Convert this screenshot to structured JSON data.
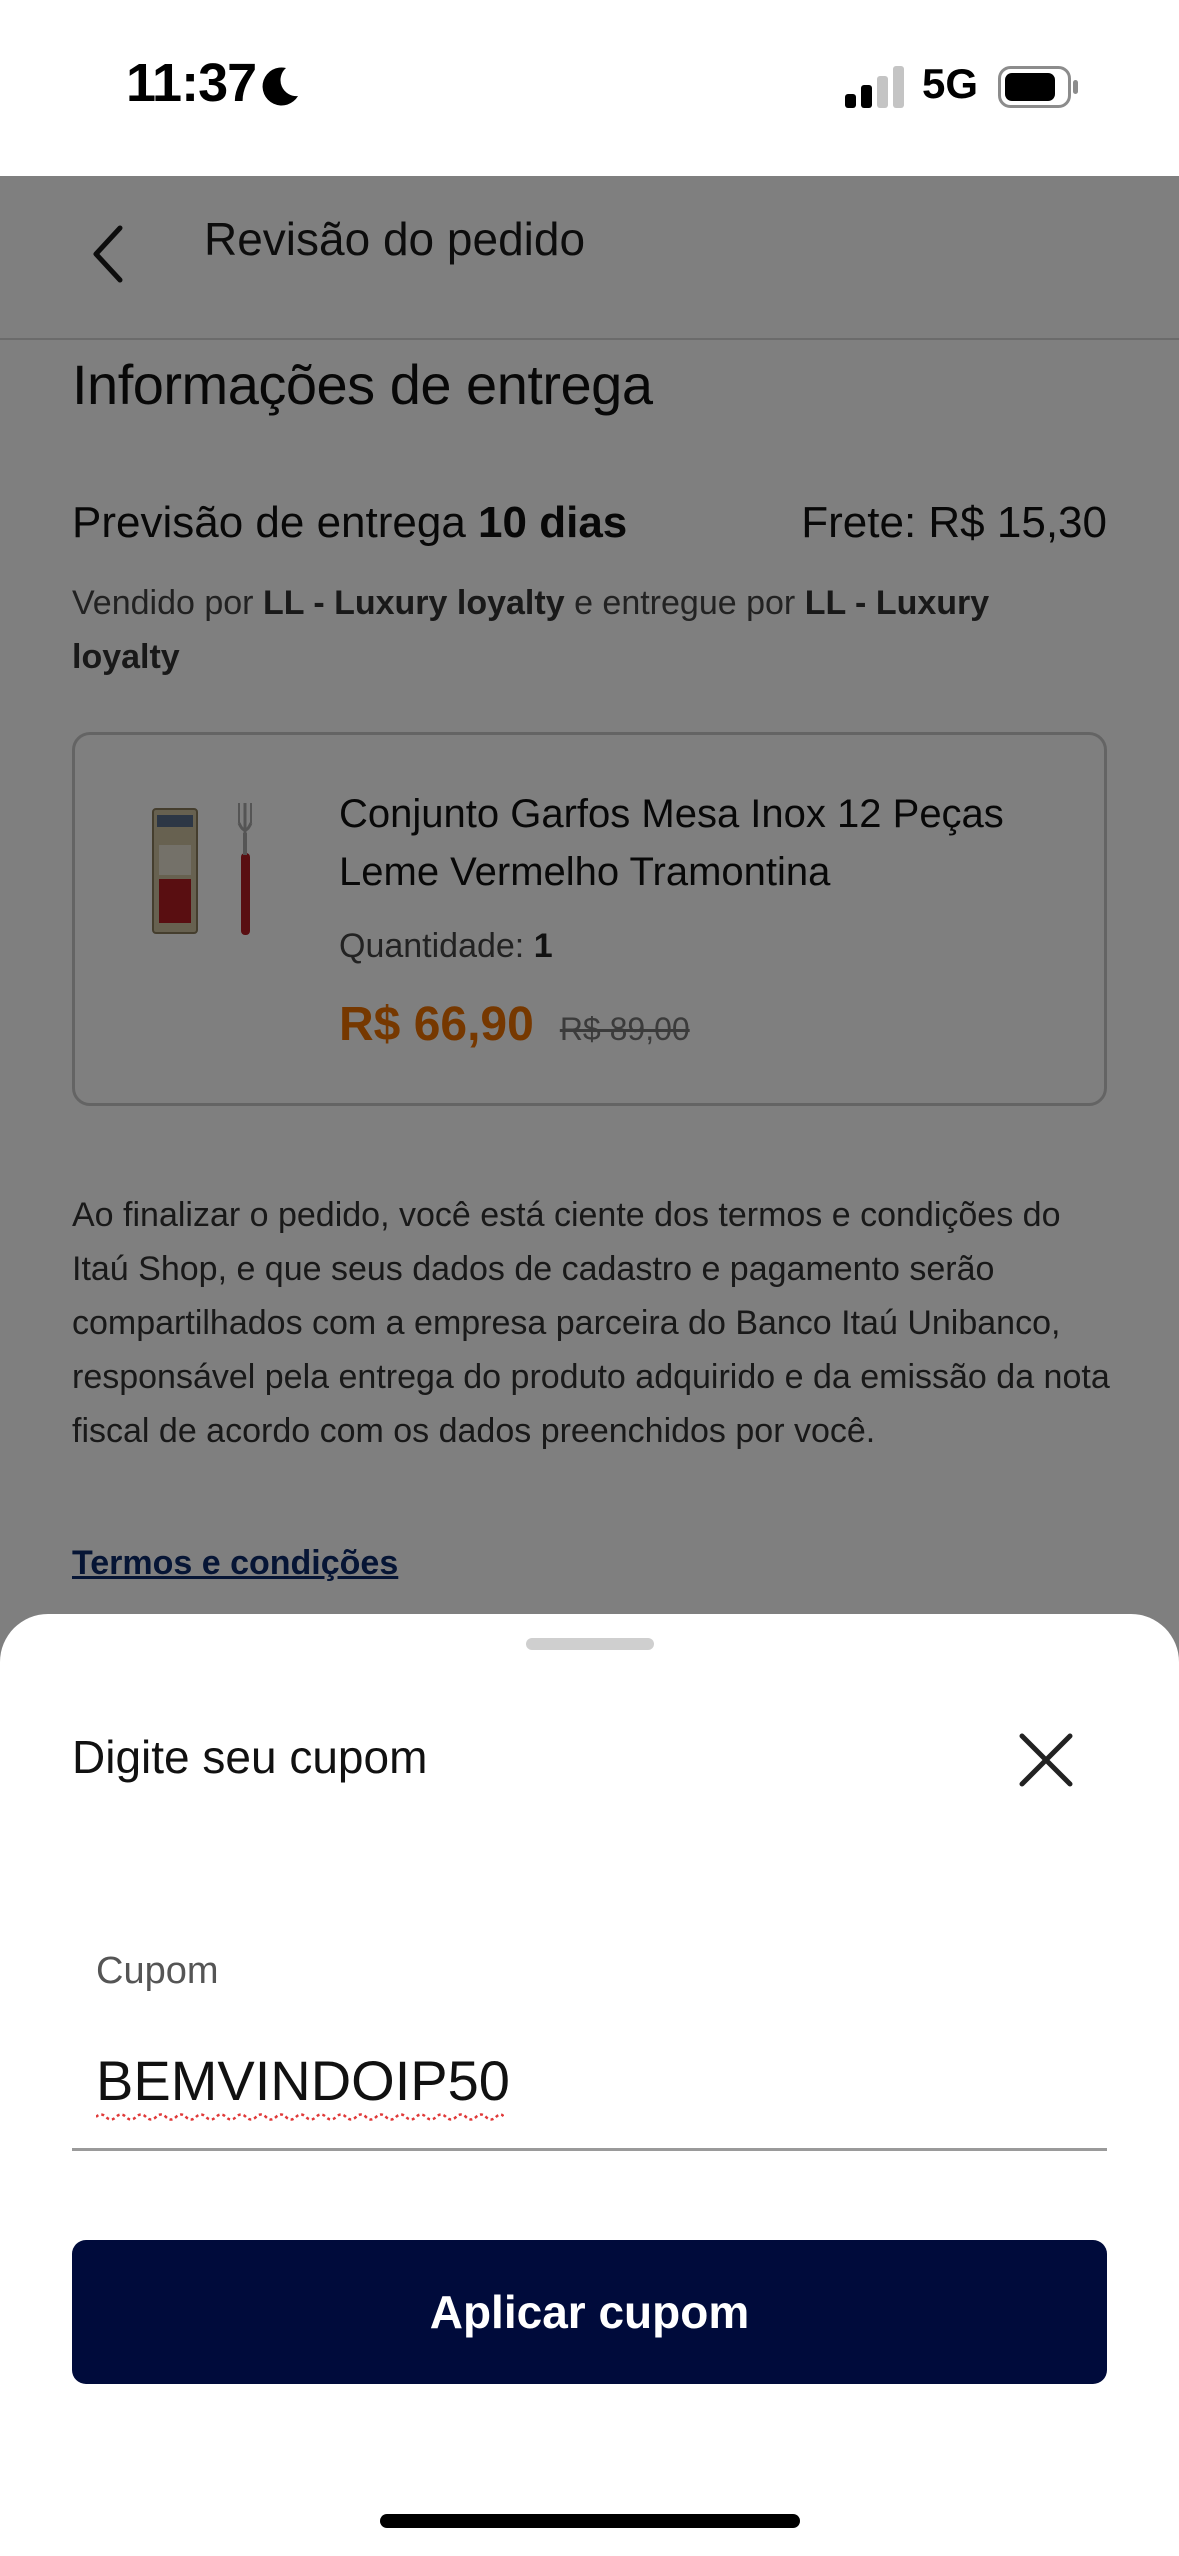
{
  "status_bar": {
    "time": "11:37",
    "network": "5G",
    "icons": [
      "moon-icon",
      "cellular-signal-icon",
      "battery-icon"
    ]
  },
  "header": {
    "title": "Revisão do pedido",
    "back_icon": "chevron-left-icon"
  },
  "delivery": {
    "section_title": "Informações de entrega",
    "eta_prefix": "Previsão de entrega",
    "eta_value": "10 dias",
    "shipping": "Frete: R$ 15,30",
    "sold_by_prefix": "Vendido por",
    "seller": "LL - Luxury loyalty",
    "delivered_by_prefix": "e entregue por",
    "deliverer": "LL - Luxury loyalty"
  },
  "product": {
    "name": "Conjunto Garfos Mesa Inox 12 Peças Leme Vermelho Tramontina",
    "quantity_label": "Quantidade:",
    "quantity": "1",
    "price": "R$ 66,90",
    "old_price": "R$ 89,00"
  },
  "disclaimer": "Ao finalizar o pedido, você está ciente dos termos e condições do Itaú Shop, e que seus dados de cadastro e pagamento serão compartilhados com a empresa parceira do Banco Itaú Unibanco, responsável pela entrega do produto adquirido e da emissão da nota fiscal de acordo com os dados preenchidos por você.",
  "terms_link": "Termos e condições",
  "coupon_sheet": {
    "title": "Digite seu cupom",
    "close_icon": "close-icon",
    "field_label": "Cupom",
    "field_value": "BEMVINDOIP50",
    "apply_button": "Aplicar cupom"
  },
  "colors": {
    "accent_orange": "#ec7000",
    "button_navy": "#000b3b",
    "link_blue": "#0c2a6b"
  }
}
